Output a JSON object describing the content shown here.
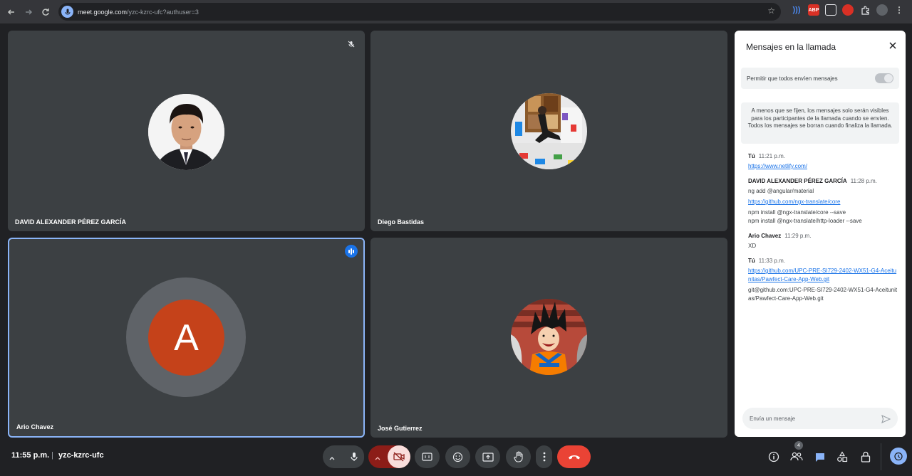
{
  "browser": {
    "url_host": "meet.google.com",
    "url_path": "/yzc-kzrc-ufc?authuser=3",
    "extensions": [
      "ABP"
    ]
  },
  "tiles": [
    {
      "name": "DAVID ALEXANDER PÉREZ GARCÍA",
      "state": "muted"
    },
    {
      "name": "Diego Bastidas"
    },
    {
      "name": "Ario Chavez",
      "initial": "A",
      "state": "speaking",
      "avatar_color": "#c5421a"
    },
    {
      "name": "José Gutierrez"
    }
  ],
  "chat": {
    "title": "Mensajes en la llamada",
    "allow_label": "Permitir que todos envíen mensajes",
    "notice": "A menos que se fijen, los mensajes solo serán visibles para los participantes de la llamada cuando se envíen. Todos los mensajes se borran cuando finaliza la llamada.",
    "messages": [
      {
        "sender": "Tú",
        "time": "11:21 p.m.",
        "lines": [
          {
            "text": "https://www.netlify.com/",
            "link": true
          }
        ]
      },
      {
        "sender": "DAVID ALEXANDER PÉREZ GARCÍA",
        "time": "11:28 p.m.",
        "lines": [
          {
            "text": "ng add @angular/material",
            "link": false
          },
          {
            "text": "https://github.com/ngx-translate/core",
            "link": true
          },
          {
            "text": " npm install @ngx-translate/core --save",
            "link": false
          },
          {
            "text": "npm install @ngx-translate/http-loader --save",
            "link": false
          }
        ]
      },
      {
        "sender": "Ario Chavez",
        "time": "11:29 p.m.",
        "lines": [
          {
            "text": "XD",
            "link": false
          }
        ]
      },
      {
        "sender": "Tú",
        "time": "11:33 p.m.",
        "lines": [
          {
            "text": "https://github.com/UPC-PRE-SI729-2402-WX51-G4-Aceitunitas/Pawfect-Care-App-Web.git",
            "link": true
          },
          {
            "text": "git@github.com:UPC-PRE-SI729-2402-WX51-G4-Aceitunitas/Pawfect-Care-App-Web.git",
            "link": false
          }
        ]
      }
    ],
    "input_placeholder": "Envía un mensaje"
  },
  "bottom": {
    "time": "11:55 p.m.",
    "separator": "|",
    "meeting_code": "yzc-kzrc-ufc",
    "participants_count": "4"
  },
  "colors": {
    "end_call": "#ea4335",
    "camera_off_bg": "#f9dedc",
    "accent": "#8ab4f8"
  }
}
